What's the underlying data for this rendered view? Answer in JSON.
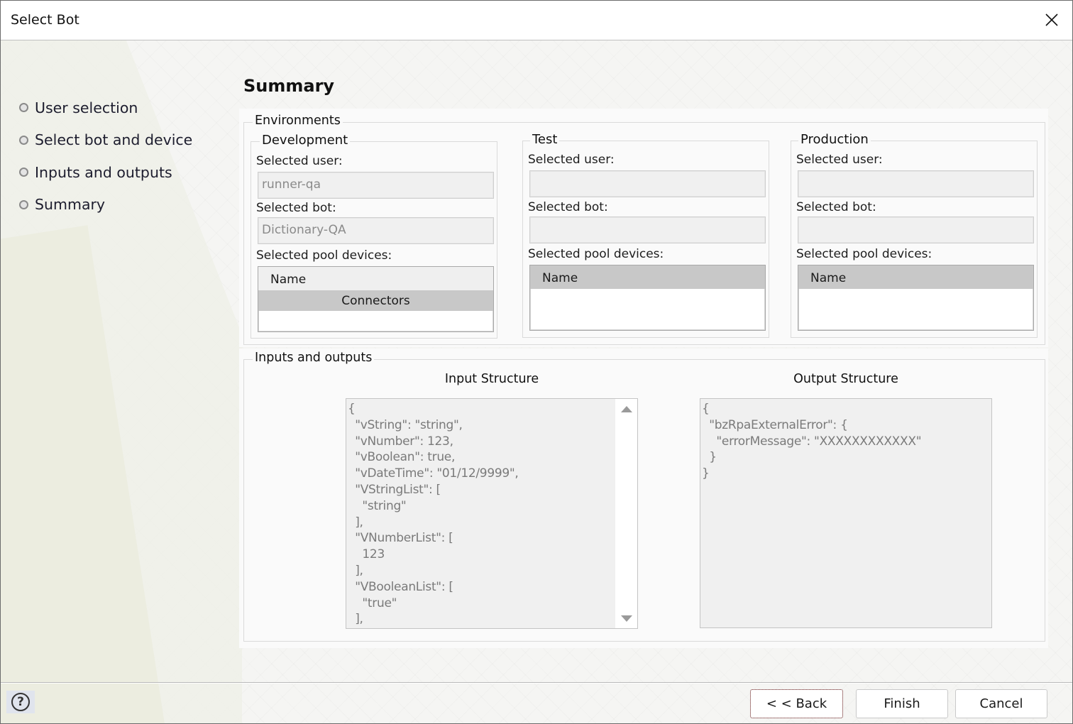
{
  "window": {
    "title": "Select Bot",
    "close_icon": "close-icon"
  },
  "sidebar": {
    "items": [
      {
        "label": "User selection"
      },
      {
        "label": "Select bot and device"
      },
      {
        "label": "Inputs and outputs"
      },
      {
        "label": "Summary"
      }
    ]
  },
  "main": {
    "heading": "Summary",
    "environments": {
      "legend": "Environments",
      "development": {
        "legend": "Development",
        "selected_user_label": "Selected user:",
        "selected_user_value": "runner-qa",
        "selected_bot_label": "Selected bot:",
        "selected_bot_value": "Dictionary-QA",
        "pool_devices_label": "Selected pool devices:",
        "grid_header": "Name",
        "rows": [
          "Connectors"
        ]
      },
      "test": {
        "legend": "Test",
        "selected_user_label": "Selected user:",
        "selected_user_value": "",
        "selected_bot_label": "Selected bot:",
        "selected_bot_value": "",
        "pool_devices_label": "Selected pool devices:",
        "grid_header": "Name",
        "rows": []
      },
      "production": {
        "legend": "Production",
        "selected_user_label": "Selected user:",
        "selected_user_value": "",
        "selected_bot_label": "Selected bot:",
        "selected_bot_value": "",
        "pool_devices_label": "Selected pool devices:",
        "grid_header": "Name",
        "rows": []
      }
    },
    "io": {
      "legend": "Inputs and outputs",
      "input_title": "Input Structure",
      "input_json": "{\n  \"vString\": \"string\",\n  \"vNumber\": 123,\n  \"vBoolean\": true,\n  \"vDateTime\": \"01/12/9999\",\n  \"VStringList\": [\n    \"string\"\n  ],\n  \"VNumberList\": [\n    123\n  ],\n  \"VBooleanList\": [\n    \"true\"\n  ],",
      "output_title": "Output Structure",
      "output_json": "{\n  \"bzRpaExternalError\": {\n    \"errorMessage\": \"XXXXXXXXXXXX\"\n  }\n}"
    }
  },
  "footer": {
    "help_label": "?",
    "back_label": "< < Back",
    "finish_label": "Finish",
    "cancel_label": "Cancel"
  }
}
